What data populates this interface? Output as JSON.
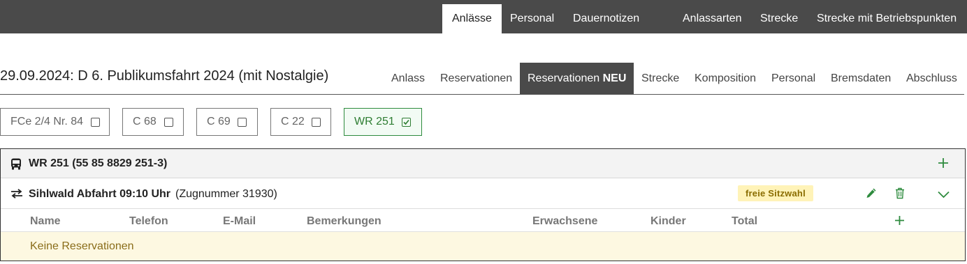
{
  "topnav": {
    "items": [
      {
        "label": "Anlässe",
        "active": true
      },
      {
        "label": "Personal"
      },
      {
        "label": "Dauernotizen"
      },
      {
        "label": "Anlassarten"
      },
      {
        "label": "Strecke"
      },
      {
        "label": "Strecke mit Betriebspunkten"
      }
    ]
  },
  "page": {
    "title": "29.09.2024: D 6. Publikumsfahrt 2024 (mit Nostalgie)"
  },
  "subtabs": [
    {
      "label": "Anlass"
    },
    {
      "label": "Reservationen"
    },
    {
      "label": "Reservationen",
      "suffix": "NEU",
      "active": true
    },
    {
      "label": "Strecke"
    },
    {
      "label": "Komposition"
    },
    {
      "label": "Personal"
    },
    {
      "label": "Bremsdaten"
    },
    {
      "label": "Abschluss"
    }
  ],
  "cars": [
    {
      "label": "FCe 2/4 Nr. 84",
      "checked": false
    },
    {
      "label": "C 68",
      "checked": false
    },
    {
      "label": "C 69",
      "checked": false
    },
    {
      "label": "C 22",
      "checked": false
    },
    {
      "label": "WR 251",
      "checked": true
    }
  ],
  "card": {
    "title": "WR 251 (55 85 8829 251-3)",
    "icon": "bus-icon",
    "trip": {
      "title": "Sihlwald Abfahrt 09:10 Uhr",
      "subtitle": "(Zugnummer 31930)",
      "badge": "freie Sitzwahl",
      "icons": [
        "pencil-icon",
        "trash-icon",
        "chevron-down-icon"
      ]
    },
    "table": {
      "columns": [
        "Name",
        "Telefon",
        "E-Mail",
        "Bemerkungen",
        "Erwachsene",
        "Kinder",
        "Total"
      ],
      "empty_text": "Keine Reservationen"
    }
  },
  "colors": {
    "topbar": "#4a4a4a",
    "accent_green": "#2e8b3e",
    "badge_bg": "#fff3b8",
    "empty_bg": "#fdf8e1"
  }
}
